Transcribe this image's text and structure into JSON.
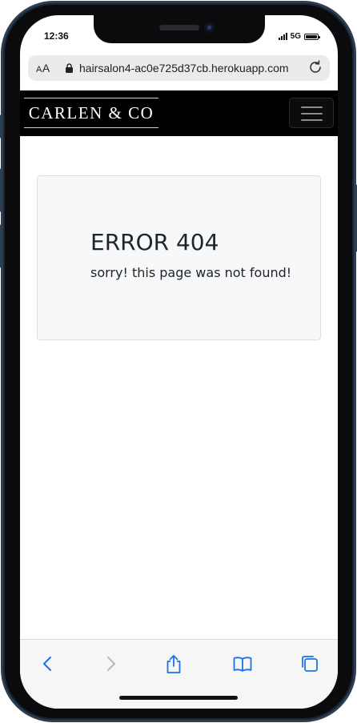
{
  "status_bar": {
    "time": "12:36",
    "network": "5G",
    "battery_percent": 100
  },
  "browser": {
    "text_size_label": "AA",
    "url": "hairsalon4-ac0e725d37cb.herokuapp.com",
    "accent_color": "#1a73e8",
    "disabled_color": "#b8b8bd"
  },
  "site": {
    "brand": "CARLEN & CO",
    "menu_icon": "hamburger-icon"
  },
  "error": {
    "title": "ERROR 404",
    "message": "sorry! this page was not found!"
  },
  "toolbar_icons": [
    "back-icon",
    "forward-icon",
    "share-icon",
    "bookmarks-icon",
    "tabs-icon"
  ]
}
